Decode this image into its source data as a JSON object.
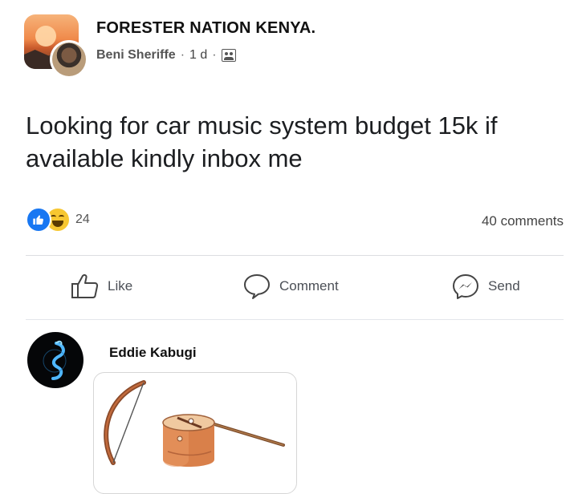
{
  "post": {
    "group_name": "FORESTER NATION KENYA.",
    "author": "Beni Sheriffe",
    "time": "1 d",
    "separator": "·",
    "text": "Looking for car music system budget 15k if available kindly inbox me",
    "privacy_icon": "group-members-icon"
  },
  "reactions": {
    "icons": [
      "like-icon",
      "haha-icon"
    ],
    "count": "24",
    "comments": "40 comments"
  },
  "actions": {
    "like": "Like",
    "comment": "Comment",
    "send": "Send"
  },
  "comment": {
    "author": "Eddie Kabugi",
    "attachment_icon": "bow-and-drum-illustration"
  },
  "colors": {
    "like_blue": "#1877f2",
    "haha_yellow": "#f7c731",
    "text": "#1c1e21",
    "muted": "#4b4f56"
  }
}
